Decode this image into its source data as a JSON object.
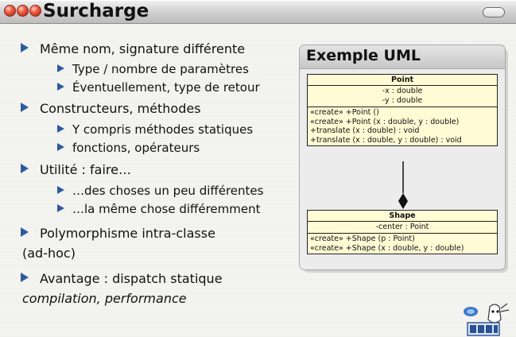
{
  "window": {
    "title": "Surcharge"
  },
  "bullets": [
    {
      "text": "Même nom, signature différente",
      "sub": [
        "Type / nombre de paramètres",
        "Éventuellement, type de retour"
      ]
    },
    {
      "text": "Constructeurs, méthodes",
      "sub": [
        "Y compris méthodes statiques",
        "fonctions, opérateurs"
      ]
    },
    {
      "text": "Utilité : faire…",
      "sub": [
        "…des choses un peu différentes",
        "…la même chose différemment"
      ]
    },
    {
      "text": "Polymorphisme intra-classe",
      "text2": "(ad-hoc)",
      "sub": []
    },
    {
      "text": "Avantage : dispatch statique",
      "text2": "compilation, performance",
      "sub": []
    }
  ],
  "uml": {
    "heading": "Exemple UML",
    "point": {
      "name": "Point",
      "attributes": [
        "-x : double",
        "-y : double"
      ],
      "operations": [
        "«create» +Point ()",
        "«create» +Point (x : double, y : double)",
        "+translate (x : double) : void",
        "+translate (x : double, y : double) : void"
      ]
    },
    "shape": {
      "name": "Shape",
      "attributes": [
        "-center : Point"
      ],
      "operations": [
        "«create» +Shape (p : Point)",
        "«create» +Shape (x : double, y : double)"
      ]
    }
  },
  "colors": {
    "bullet": "#2f5aa3",
    "class_fill": "#fffbd4"
  },
  "icons": {
    "window_buttons": "traffic-light-icons",
    "logo": "lrde-logo"
  }
}
